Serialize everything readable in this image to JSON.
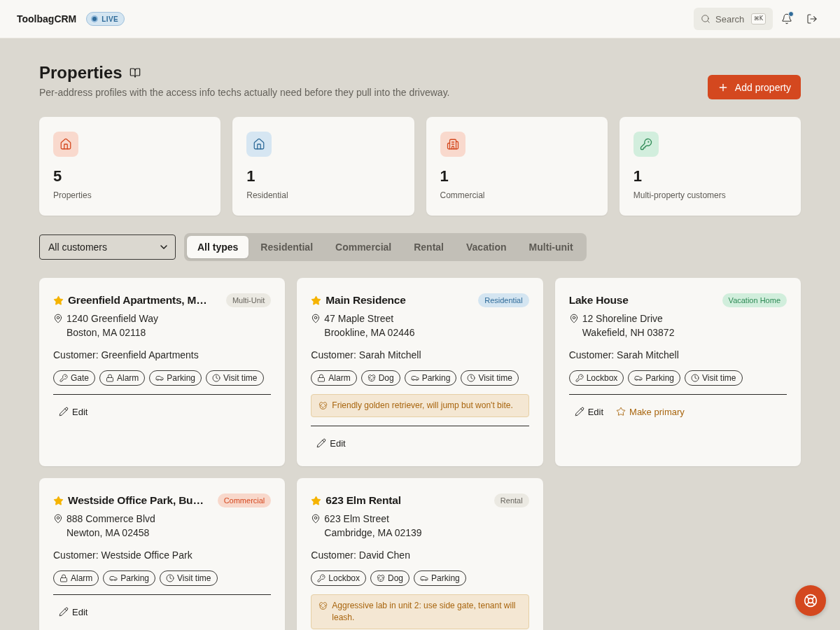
{
  "header": {
    "app_name": "ToolbagCRM",
    "status_badge": "LIVE",
    "search": {
      "label": "Search",
      "shortcut": "⌘K"
    },
    "notifications": {
      "unread": true
    }
  },
  "page": {
    "title": "Properties",
    "subtitle": "Per-address profiles with the access info techs actually need before they pull into the driveway.",
    "add_button": "Add property"
  },
  "stats": [
    {
      "kind": "properties",
      "value": "5",
      "label": "Properties"
    },
    {
      "kind": "residential",
      "value": "1",
      "label": "Residential"
    },
    {
      "kind": "commercial",
      "value": "1",
      "label": "Commercial"
    },
    {
      "kind": "customers",
      "value": "1",
      "label": "Multi-property customers"
    }
  ],
  "filters": {
    "customer_select": "All customers",
    "type_tabs": [
      {
        "label": "All types",
        "selected": true
      },
      {
        "label": "Residential",
        "selected": false
      },
      {
        "label": "Commercial",
        "selected": false
      },
      {
        "label": "Rental",
        "selected": false
      },
      {
        "label": "Vacation",
        "selected": false
      },
      {
        "label": "Multi-unit",
        "selected": false
      }
    ]
  },
  "properties": [
    {
      "name": "Greenfield Apartments, M…",
      "primary": true,
      "type": {
        "label": "Multi-Unit",
        "kind": "multi_unit"
      },
      "address": [
        "1240 Greenfield Way",
        "Boston, MA 02118"
      ],
      "customer": "Customer: Greenfield Apartments",
      "access": [
        {
          "kind": "key",
          "label": "Gate"
        },
        {
          "kind": "lock",
          "label": "Alarm"
        },
        {
          "kind": "car",
          "label": "Parking"
        },
        {
          "kind": "clock",
          "label": "Visit time"
        }
      ],
      "actions": [
        {
          "kind": "edit",
          "label": "Edit"
        }
      ]
    },
    {
      "name": "Main Residence",
      "primary": true,
      "type": {
        "label": "Residential",
        "kind": "residential"
      },
      "address": [
        "47 Maple Street",
        "Brookline, MA 02446"
      ],
      "customer": "Customer: Sarah Mitchell",
      "access": [
        {
          "kind": "lock",
          "label": "Alarm"
        },
        {
          "kind": "dog",
          "label": "Dog"
        },
        {
          "kind": "car",
          "label": "Parking"
        },
        {
          "kind": "clock",
          "label": "Visit time"
        }
      ],
      "note": "Friendly golden retriever, will jump but won't bite.",
      "actions": [
        {
          "kind": "edit",
          "label": "Edit"
        }
      ]
    },
    {
      "name": "Lake House",
      "primary": false,
      "type": {
        "label": "Vacation Home",
        "kind": "vacation"
      },
      "address": [
        "12 Shoreline Drive",
        "Wakefield, NH 03872"
      ],
      "customer": "Customer: Sarah Mitchell",
      "access": [
        {
          "kind": "key",
          "label": "Lockbox"
        },
        {
          "kind": "car",
          "label": "Parking"
        },
        {
          "kind": "clock",
          "label": "Visit time"
        }
      ],
      "actions": [
        {
          "kind": "edit",
          "label": "Edit"
        },
        {
          "kind": "make_primary",
          "label": "Make primary"
        }
      ]
    },
    {
      "name": "Westside Office Park, Bu…",
      "primary": true,
      "type": {
        "label": "Commercial",
        "kind": "commercial"
      },
      "address": [
        "888 Commerce Blvd",
        "Newton, MA 02458"
      ],
      "customer": "Customer: Westside Office Park",
      "access": [
        {
          "kind": "lock",
          "label": "Alarm"
        },
        {
          "kind": "car",
          "label": "Parking"
        },
        {
          "kind": "clock",
          "label": "Visit time"
        }
      ],
      "actions": [
        {
          "kind": "edit",
          "label": "Edit"
        }
      ]
    },
    {
      "name": "623 Elm Rental",
      "primary": true,
      "type": {
        "label": "Rental",
        "kind": "rental"
      },
      "address": [
        "623 Elm Street",
        "Cambridge, MA 02139"
      ],
      "customer": "Customer: David Chen",
      "access": [
        {
          "kind": "key",
          "label": "Lockbox"
        },
        {
          "kind": "dog",
          "label": "Dog"
        },
        {
          "kind": "car",
          "label": "Parking"
        }
      ],
      "note": "Aggressive lab in unit 2: use side gate, tenant will leash."
    }
  ]
}
